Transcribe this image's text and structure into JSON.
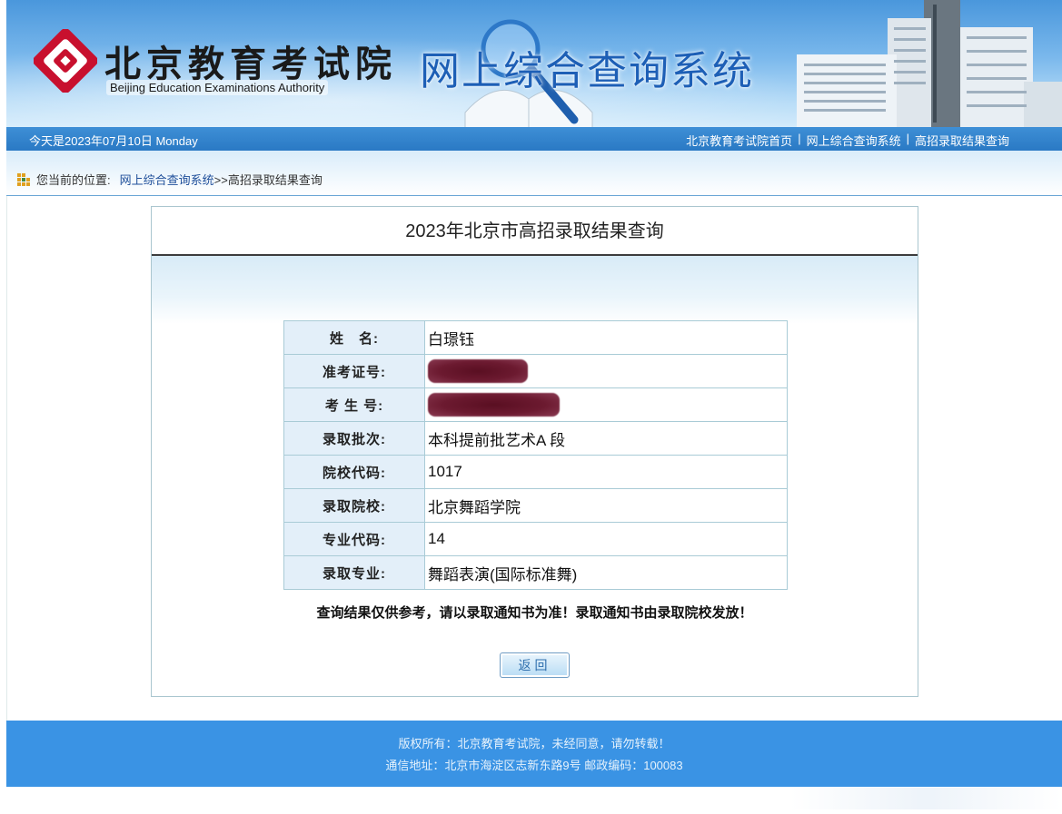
{
  "header": {
    "brand_cn": "北京教育考试院",
    "brand_en": "Beijing Education Examinations Authority",
    "system_title": "网上综合查询系统"
  },
  "nav": {
    "date": "今天是2023年07月10日 Monday",
    "links": [
      "北京教育考试院首页",
      "网上综合查询系统",
      "高招录取结果查询"
    ],
    "separator": "|"
  },
  "breadcrumb": {
    "label": "您当前的位置:",
    "link": "网上综合查询系统",
    "current": ">>高招录取结果查询"
  },
  "result": {
    "title": "2023年北京市高招录取结果查询",
    "rows": [
      {
        "label": "姓　名:",
        "value": "白璟钰",
        "redacted": false
      },
      {
        "label": "准考证号:",
        "value": "",
        "redacted": true
      },
      {
        "label": "考 生 号:",
        "value": "",
        "redacted": true
      },
      {
        "label": "录取批次:",
        "value": "本科提前批艺术A 段",
        "redacted": false
      },
      {
        "label": "院校代码:",
        "value": "1017",
        "redacted": false
      },
      {
        "label": "录取院校:",
        "value": "北京舞蹈学院",
        "redacted": false
      },
      {
        "label": "专业代码:",
        "value": "14",
        "redacted": false
      },
      {
        "label": "录取专业:",
        "value": "舞蹈表演(国际标准舞)",
        "redacted": false
      }
    ],
    "notice": "查询结果仅供参考，请以录取通知书为准！录取通知书由录取院校发放！",
    "back_label": "返回"
  },
  "footer": {
    "line1": "版权所有：北京教育考试院，未经同意，请勿转载！",
    "line2": "通信地址：北京市海淀区志新东路9号 邮政编码：100083"
  },
  "colors": {
    "header_blue": "#4a97dc",
    "nav_blue": "#2a79c4",
    "footer_blue": "#3a93e4",
    "logo_red": "#c8102e",
    "label_bg": "#e3eff9",
    "redaction": "#6c1a30"
  }
}
